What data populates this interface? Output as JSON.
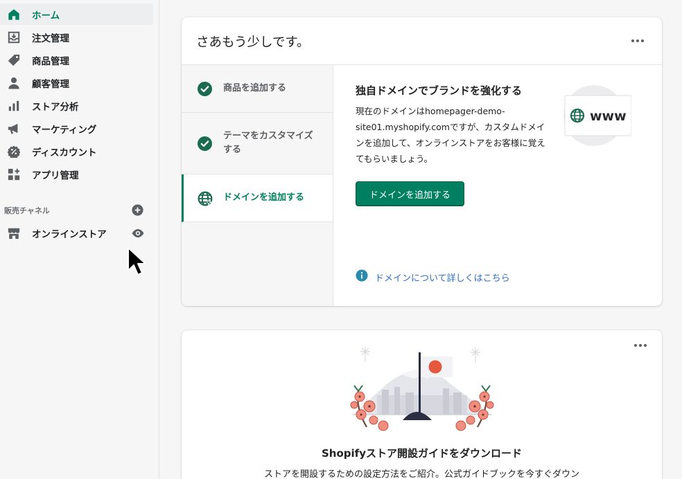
{
  "nav": {
    "items": [
      {
        "label": "ホーム",
        "icon": "home-icon",
        "active": true
      },
      {
        "label": "注文管理",
        "icon": "orders-icon"
      },
      {
        "label": "商品管理",
        "icon": "tag-icon"
      },
      {
        "label": "顧客管理",
        "icon": "person-icon"
      },
      {
        "label": "ストア分析",
        "icon": "bar-chart-icon"
      },
      {
        "label": "マーケティング",
        "icon": "megaphone-icon"
      },
      {
        "label": "ディスカウント",
        "icon": "discount-icon"
      },
      {
        "label": "アプリ管理",
        "icon": "apps-icon"
      }
    ],
    "sales_channels_title": "販売チャネル",
    "online_store_label": "オンラインストア"
  },
  "setup_card": {
    "title": "さあもう少しです。",
    "steps": [
      {
        "label": "商品を追加する",
        "status": "done"
      },
      {
        "label": "テーマをカスタマイズする",
        "status": "done"
      },
      {
        "label": "ドメインを追加する",
        "status": "active"
      }
    ],
    "detail": {
      "title": "独自ドメインでブランドを強化する",
      "text": "現在のドメインはhomepager-demo-site01.myshopify.comですが、カスタムドメインを追加して、オンラインストアをお客様に覚えてもらいましょう。",
      "button_label": "ドメインを追加する",
      "link_label": "ドメインについて詳しくはこちら",
      "graphic_text": "www"
    }
  },
  "guide_card": {
    "title": "Shopifyストア開設ガイドをダウンロード",
    "text": "ストアを開設するための設定方法をご紹介。公式ガイドブックを今すぐダウン"
  },
  "colors": {
    "accent": "#008060",
    "link": "#2c6ecb",
    "sidebar_bg": "#f6f6f7",
    "flag_red": "#e4583e"
  }
}
